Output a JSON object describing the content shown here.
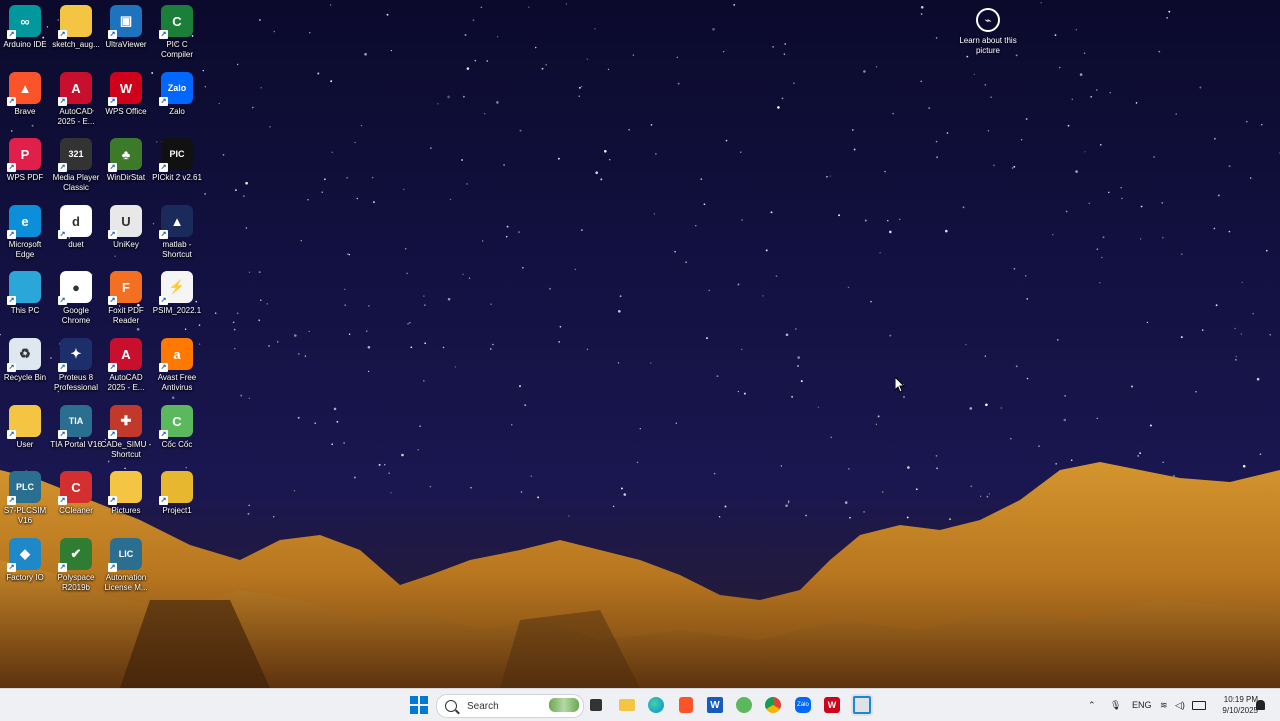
{
  "desktop_icons": [
    {
      "label": "Arduino IDE",
      "name": "arduino-ide-icon",
      "color": "#00979d",
      "glyph": "∞"
    },
    {
      "label": "sketch_aug...",
      "name": "sketch-folder-icon",
      "color": "#f4c542",
      "glyph": ""
    },
    {
      "label": "UltraViewer",
      "name": "ultraviewer-icon",
      "color": "#1e73be",
      "glyph": "▣"
    },
    {
      "label": "PIC C Compiler",
      "name": "pic-c-compiler-icon",
      "color": "#1b7f3a",
      "glyph": "C"
    },
    {
      "label": "Brave",
      "name": "brave-icon",
      "color": "#fb542b",
      "glyph": "▲"
    },
    {
      "label": "AutoCAD 2025 - E...",
      "name": "autocad-icon",
      "color": "#c8102e",
      "glyph": "A"
    },
    {
      "label": "WPS Office",
      "name": "wps-office-icon",
      "color": "#d0021b",
      "glyph": "W"
    },
    {
      "label": "Zalo",
      "name": "zalo-icon",
      "color": "#0068ff",
      "glyph": "Zalo"
    },
    {
      "label": "WPS PDF",
      "name": "wps-pdf-icon",
      "color": "#e0204a",
      "glyph": "P"
    },
    {
      "label": "Media Player Classic",
      "name": "media-player-classic-icon",
      "color": "#333333",
      "glyph": "321"
    },
    {
      "label": "WinDirStat",
      "name": "windirstat-icon",
      "color": "#3c7a2a",
      "glyph": "♣"
    },
    {
      "label": "PICkit 2 v2.61",
      "name": "pickit-icon",
      "color": "#111111",
      "glyph": "PIC"
    },
    {
      "label": "Microsoft Edge",
      "name": "microsoft-edge-icon",
      "color": "#0c8fd8",
      "glyph": "e"
    },
    {
      "label": "duet",
      "name": "duet-icon",
      "color": "#ffffff",
      "glyph": "d"
    },
    {
      "label": "UniKey",
      "name": "unikey-icon",
      "color": "#e8e8e8",
      "glyph": "U"
    },
    {
      "label": "matlab - Shortcut",
      "name": "matlab-icon",
      "color": "#1a2a5a",
      "glyph": "▲"
    },
    {
      "label": "This PC",
      "name": "this-pc-icon",
      "color": "#2aa6d9",
      "glyph": ""
    },
    {
      "label": "Google Chrome",
      "name": "google-chrome-icon",
      "color": "#ffffff",
      "glyph": "●"
    },
    {
      "label": "Foxit PDF Reader",
      "name": "foxit-pdf-icon",
      "color": "#f36f21",
      "glyph": "F"
    },
    {
      "label": "PSIM_2022.1",
      "name": "psim-icon",
      "color": "#f5f5f5",
      "glyph": "⚡"
    },
    {
      "label": "Recycle Bin",
      "name": "recycle-bin-icon",
      "color": "#dfe8f0",
      "glyph": "♻"
    },
    {
      "label": "Proteus 8 Professional",
      "name": "proteus-icon",
      "color": "#1c2f6b",
      "glyph": "✦"
    },
    {
      "label": "AutoCAD 2025 - E...",
      "name": "autocad-2-icon",
      "color": "#c8102e",
      "glyph": "A"
    },
    {
      "label": "Avast Free Antivirus",
      "name": "avast-icon",
      "color": "#ff7800",
      "glyph": "a"
    },
    {
      "label": "User",
      "name": "user-folder-icon",
      "color": "#f4c542",
      "glyph": ""
    },
    {
      "label": "TIA Portal V16",
      "name": "tia-portal-icon",
      "color": "#2a6f8f",
      "glyph": "TIA"
    },
    {
      "label": "CADe_SIMU - Shortcut",
      "name": "cade-simu-icon",
      "color": "#c0392b",
      "glyph": "✚"
    },
    {
      "label": "Cốc Cốc",
      "name": "coc-coc-icon",
      "color": "#5cb85c",
      "glyph": "C"
    },
    {
      "label": "S7-PLCSIM V16",
      "name": "plcsim-icon",
      "color": "#2a6f8f",
      "glyph": "PLC"
    },
    {
      "label": "CCleaner",
      "name": "ccleaner-icon",
      "color": "#d32f2f",
      "glyph": "C"
    },
    {
      "label": "Pictures",
      "name": "pictures-folder-icon",
      "color": "#f4c542",
      "glyph": ""
    },
    {
      "label": "Project1",
      "name": "project1-folder-icon",
      "color": "#e8b730",
      "glyph": ""
    },
    {
      "label": "Factory IO",
      "name": "factory-io-icon",
      "color": "#1e88c8",
      "glyph": "◆"
    },
    {
      "label": "Polyspace R2019b",
      "name": "polyspace-icon",
      "color": "#2e7d32",
      "glyph": "✔"
    },
    {
      "label": "Automation License M...",
      "name": "automation-license-icon",
      "color": "#2a6f8f",
      "glyph": "LIC"
    }
  ],
  "learn_picture": {
    "label": "Learn about this picture"
  },
  "taskbar": {
    "search_placeholder": "Search",
    "tray_lang": "ENG",
    "time": "10:19 PM",
    "date": "9/10/2025"
  }
}
